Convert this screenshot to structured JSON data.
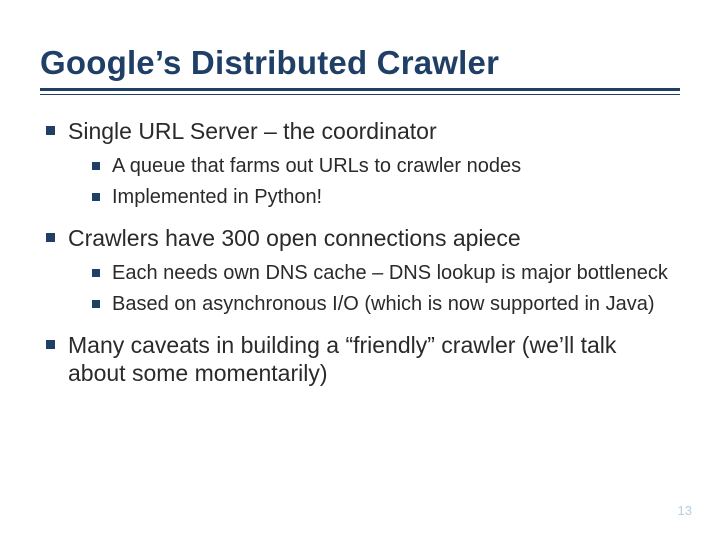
{
  "title": "Google’s Distributed Crawler",
  "bullets": {
    "b0": "Single URL Server – the coordinator",
    "b0s0": "A queue that farms out URLs to crawler nodes",
    "b0s1": "Implemented in Python!",
    "b1": "Crawlers have 300 open connections apiece",
    "b1s0": "Each needs own DNS cache – DNS lookup is major bottleneck",
    "b1s1": "Based on asynchronous I/O (which is now supported in Java)",
    "b2": "Many caveats in building a “friendly” crawler (we’ll talk about some momentarily)"
  },
  "page_number": "13"
}
